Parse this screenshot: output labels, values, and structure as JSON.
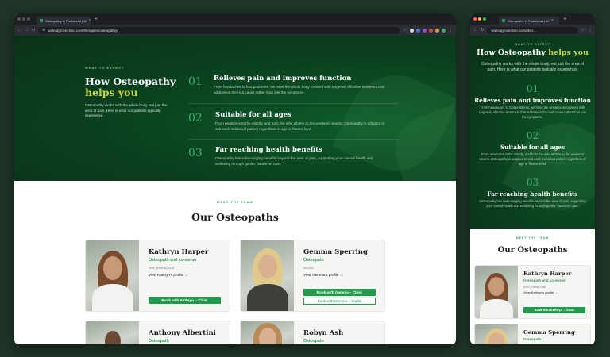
{
  "tab_title": "Osteopathy in Portishead | W",
  "tab_title_mobile": "Osteopathy in Portishead | W",
  "url": "walnutgroveclinic.com/therapies/osteopathy/",
  "url_mobile": "walnutgroveclinic.com/ther...",
  "hero": {
    "eyebrow": "WHAT TO EXPECT",
    "title_main": "How Osteopathy",
    "title_accent": "helps you",
    "intro": "Osteopathy works with the whole body, not just the area of pain. Here is what our patients typically experience.",
    "items": [
      {
        "num": "01",
        "title": "Relieves pain and improves function",
        "desc": "From headaches to foot problems, we have the whole body covered with targeted, effective treatment that addresses the root cause rather than just the symptoms."
      },
      {
        "num": "02",
        "title": "Suitable for all ages",
        "desc": "From newborns to the elderly, and from the elite athlete to the weekend warrior. Osteopathy is adapted to suit each individual patient regardless of age or fitness level."
      },
      {
        "num": "03",
        "title": "Far reaching health benefits",
        "desc": "Osteopathy has wide-ranging benefits beyond the area of pain, supporting your overall health and wellbeing through gentle, hands-on care."
      }
    ]
  },
  "team": {
    "eyebrow": "MEET THE TEAM",
    "title": "Our Osteopaths",
    "members": [
      {
        "name": "Kathryn Harper",
        "role": "Osteopath and co-owner",
        "qual": "BSc (Hons) Ost",
        "link": "View Kathryn's profile →",
        "btn1": "Book with Kathryn – Clinic"
      },
      {
        "name": "Gemma Sperring",
        "role": "Osteopath",
        "qual": "M.Ost",
        "link": "View Gemma's profile →",
        "btn1": "Book with Gemma – Clinic",
        "btn2": "Book with Gemma – Studio"
      },
      {
        "name": "Anthony Albertini",
        "role": "Osteopath"
      },
      {
        "name": "Robyn Ash",
        "role": "Osteopath"
      }
    ]
  },
  "colors": {
    "hero_bg": "#0a3f1f",
    "accent_lime": "#c9d63e",
    "brand_green": "#1f9a4b"
  }
}
